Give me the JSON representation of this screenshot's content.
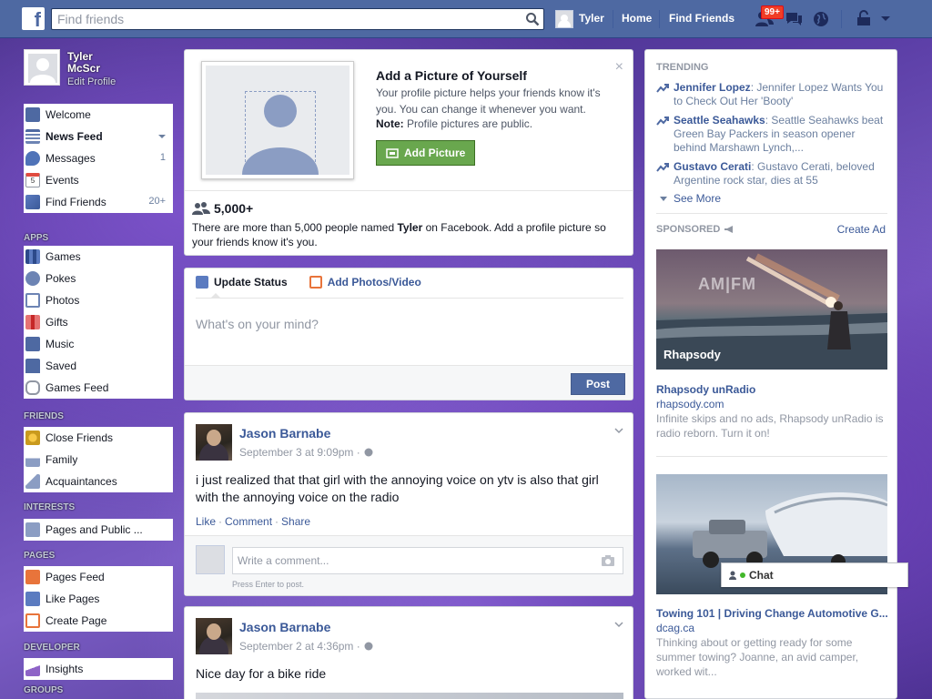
{
  "topbar": {
    "search_placeholder": "Find friends",
    "user_name": "Tyler",
    "home": "Home",
    "find_friends": "Find Friends",
    "friend_requests_badge": "99+"
  },
  "profile": {
    "name_line1": "Tyler",
    "name_line2": "McScr",
    "edit": "Edit Profile"
  },
  "nav": {
    "welcome": "Welcome",
    "news_feed": "News Feed",
    "messages": "Messages",
    "messages_count": "1",
    "events": "Events",
    "events_day": "5",
    "find_friends": "Find Friends",
    "find_friends_count": "20+",
    "apps_head": "APPS",
    "games": "Games",
    "pokes": "Pokes",
    "photos": "Photos",
    "gifts": "Gifts",
    "music": "Music",
    "saved": "Saved",
    "games_feed": "Games Feed",
    "friends_head": "FRIENDS",
    "close_friends": "Close Friends",
    "family": "Family",
    "acquaintances": "Acquaintances",
    "interests_head": "INTERESTS",
    "pages_public": "Pages and Public ...",
    "pages_head": "PAGES",
    "pages_feed": "Pages Feed",
    "like_pages": "Like Pages",
    "create_page": "Create Page",
    "developer_head": "DEVELOPER",
    "insights": "Insights",
    "groups_head": "GROUPS"
  },
  "profile_prompt": {
    "title": "Add a Picture of Yourself",
    "text": "Your profile picture helps your friends know it's you. You can change it whenever you want.",
    "note_label": "Note:",
    "note_text": " Profile pictures are public.",
    "button": "Add Picture",
    "close": "×",
    "count": "5,000+",
    "desc_pre": "There are more than 5,000 people named ",
    "desc_name": "Tyler",
    "desc_post": " on Facebook. Add a profile picture so your friends know it's you."
  },
  "composer": {
    "tab_status": "Update Status",
    "tab_photos": "Add Photos/Video",
    "placeholder": "What's on your mind?",
    "post_button": "Post"
  },
  "posts": [
    {
      "author": "Jason Barnabe",
      "time": "September 3 at 9:09pm · ",
      "body": "i just realized that that girl with the annoying voice on ytv is also that girl with the annoying voice on the radio",
      "like": "Like",
      "comment": "Comment",
      "share": "Share",
      "comment_placeholder": "Write a comment...",
      "press_enter": "Press Enter to post."
    },
    {
      "author": "Jason Barnabe",
      "time": "September 2 at 4:36pm · ",
      "body": "Nice day for a bike ride"
    }
  ],
  "trending": {
    "head": "TRENDING",
    "items": [
      {
        "topic": "Jennifer Lopez",
        "text": ": Jennifer Lopez Wants You to Check Out Her 'Booty'"
      },
      {
        "topic": "Seattle Seahawks",
        "text": ": Seattle Seahawks beat Green Bay Packers in season opener behind Marshawn Lynch,..."
      },
      {
        "topic": "Gustavo Cerati",
        "text": ": Gustavo Cerati, beloved Argentine rock star, dies at 55"
      }
    ],
    "see_more": "See More"
  },
  "sponsored": {
    "head": "SPONSORED",
    "create_ad": "Create Ad",
    "ads": [
      {
        "image_logo": "AM|FM",
        "image_brand": "Rhapsody",
        "title": "Rhapsody unRadio",
        "domain": "rhapsody.com",
        "desc": "Infinite skips and no ads, Rhapsody unRadio is radio reborn. Turn it on!"
      },
      {
        "title": "Towing 101 | Driving Change Automotive G...",
        "domain": "dcag.ca",
        "desc": "Thinking about or getting ready for some summer towing? Joanne, an avid camper, worked wit..."
      }
    ]
  },
  "chat": {
    "label": "Chat"
  },
  "colors": {
    "brand": "#4e69a2",
    "link": "#3b5998",
    "add_picture_green": "#69a74e",
    "badge_red": "#f03d25"
  }
}
